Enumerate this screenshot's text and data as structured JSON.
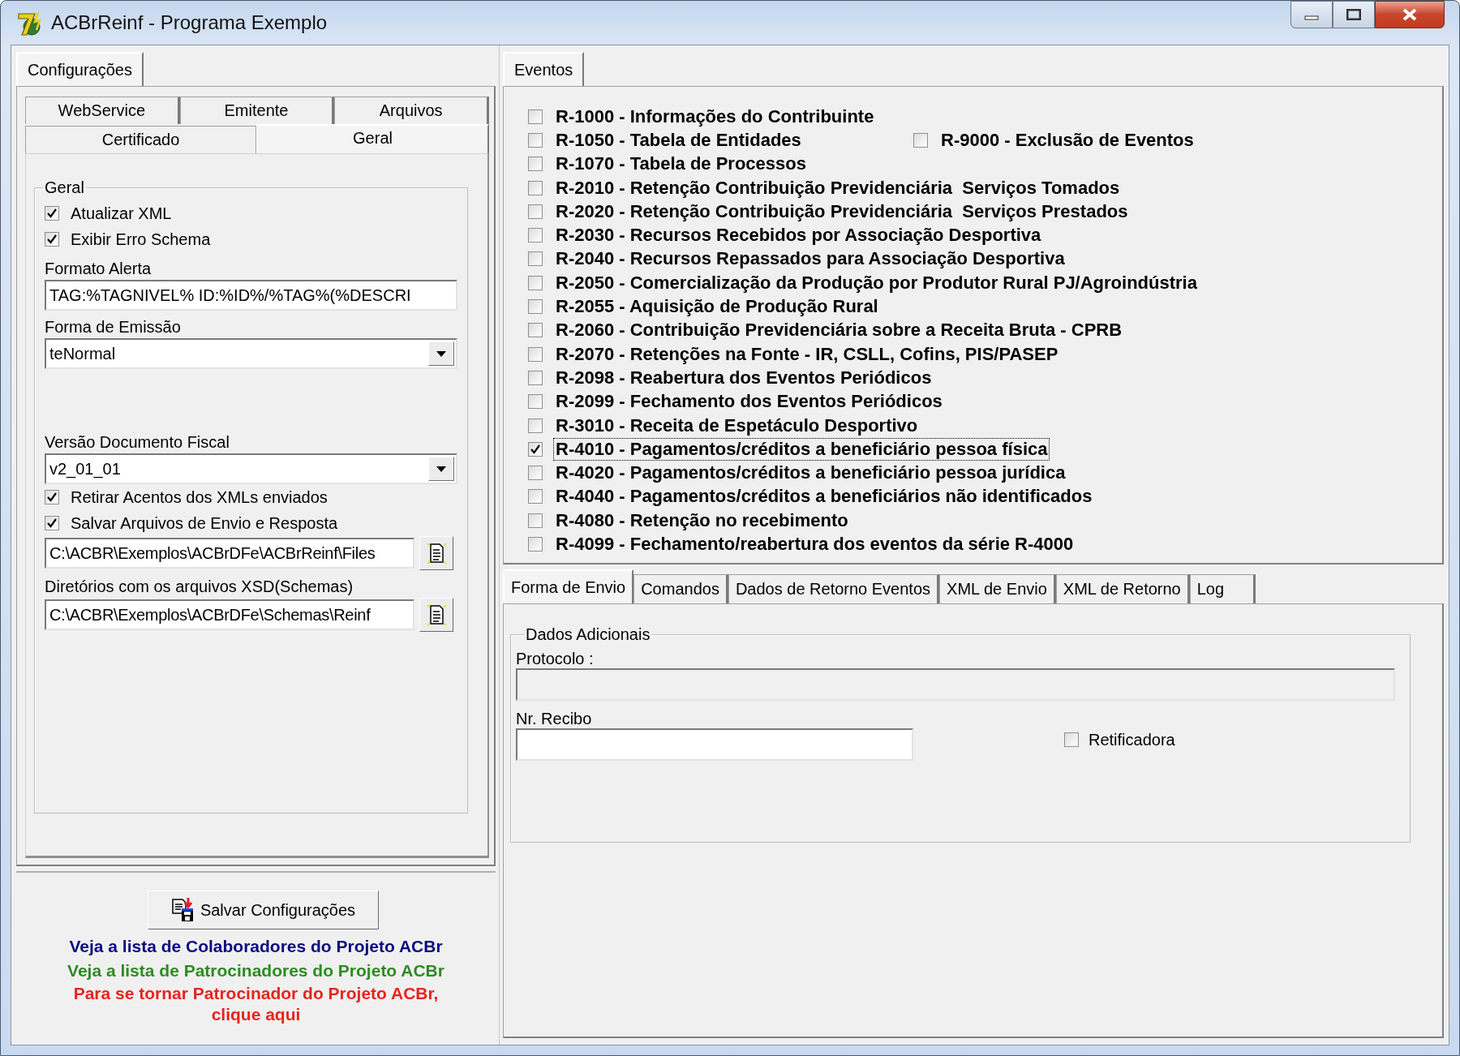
{
  "window": {
    "title": "ACBrReinf - Programa Exemplo"
  },
  "config": {
    "tab": {
      "label": "Configurações",
      "selected": true
    },
    "subtab_rows": [
      [
        {
          "label": "WebService",
          "selected": false
        },
        {
          "label": "Emitente",
          "selected": false
        },
        {
          "label": "Arquivos",
          "selected": false
        }
      ],
      [
        {
          "label": "Certificado",
          "selected": false
        },
        {
          "label": "Geral",
          "selected": true
        }
      ]
    ],
    "group_title": "Geral",
    "fields": [
      {
        "kind": "checkbox",
        "label": "Atualizar XML",
        "checked": true
      },
      {
        "kind": "checkbox",
        "label": "Exibir Erro Schema",
        "checked": true
      },
      {
        "kind": "label",
        "text": "Formato Alerta"
      },
      {
        "kind": "input",
        "value": "TAG:%TAGNIVEL% ID:%ID%/%TAG%(%DESCRI"
      },
      {
        "kind": "label",
        "text": "Forma de Emissão"
      },
      {
        "kind": "select",
        "value": "teNormal"
      },
      {
        "kind": "label",
        "text": "Versão Documento Fiscal"
      },
      {
        "kind": "select",
        "value": "v2_01_01"
      },
      {
        "kind": "checkbox",
        "label": "Retirar Acentos dos XMLs enviados",
        "checked": true
      },
      {
        "kind": "checkbox",
        "label": "Salvar Arquivos de Envio e Resposta",
        "checked": true
      },
      {
        "kind": "path",
        "value": "C:\\ACBR\\Exemplos\\ACBrDFe\\ACBrReinf\\Files"
      },
      {
        "kind": "label",
        "text": "Diretórios com os arquivos XSD(Schemas)"
      },
      {
        "kind": "path",
        "value": "C:\\ACBR\\Exemplos\\ACBrDFe\\Schemas\\Reinf"
      }
    ]
  },
  "save_button": {
    "label": "Salvar Configurações"
  },
  "links": [
    {
      "text": "Veja a lista de Colaboradores do Projeto ACBr",
      "color": "#0a0a80"
    },
    {
      "text": "Veja a lista de Patrocinadores do Projeto ACBr",
      "color": "#2e8b22"
    },
    {
      "text": "Para se tornar Patrocinador do Projeto ACBr, clique aqui",
      "color": "#e8231d"
    }
  ],
  "events_tab": {
    "label": "Eventos",
    "selected": true
  },
  "events": [
    {
      "label": "R-1000 - Informações do Contribuinte",
      "checked": false,
      "focused": false
    },
    {
      "label": "R-1050 - Tabela de Entidades",
      "checked": false,
      "focused": false,
      "beside": {
        "label": "R-9000 - Exclusão de Eventos",
        "checked": false
      }
    },
    {
      "label": "R-1070 - Tabela de Processos",
      "checked": false,
      "focused": false
    },
    {
      "label": "R-2010 - Retenção Contribuição Previdenciária  Serviços Tomados",
      "checked": false,
      "focused": false
    },
    {
      "label": "R-2020 - Retenção Contribuição Previdenciária  Serviços Prestados",
      "checked": false,
      "focused": false
    },
    {
      "label": "R-2030 - Recursos Recebidos por Associação Desportiva",
      "checked": false,
      "focused": false
    },
    {
      "label": "R-2040 - Recursos Repassados para Associação Desportiva",
      "checked": false,
      "focused": false
    },
    {
      "label": "R-2050 - Comercialização da Produção por Produtor Rural PJ/Agroindústria",
      "checked": false,
      "focused": false
    },
    {
      "label": "R-2055 - Aquisição de Produção Rural",
      "checked": false,
      "focused": false
    },
    {
      "label": "R-2060 - Contribuição Previdenciária sobre a Receita Bruta - CPRB",
      "checked": false,
      "focused": false
    },
    {
      "label": "R-2070 - Retenções na Fonte - IR, CSLL, Cofins, PIS/PASEP",
      "checked": false,
      "focused": false
    },
    {
      "label": "R-2098 - Reabertura dos Eventos Periódicos",
      "checked": false,
      "focused": false
    },
    {
      "label": "R-2099 - Fechamento dos Eventos Periódicos",
      "checked": false,
      "focused": false
    },
    {
      "label": "R-3010 - Receita de Espetáculo Desportivo",
      "checked": false,
      "focused": false
    },
    {
      "label": "R-4010 - Pagamentos/créditos a beneficiário pessoa física",
      "checked": true,
      "focused": true
    },
    {
      "label": "R-4020 - Pagamentos/créditos a beneficiário pessoa jurídica",
      "checked": false,
      "focused": false
    },
    {
      "label": "R-4040 - Pagamentos/créditos a beneficiários não identificados",
      "checked": false,
      "focused": false
    },
    {
      "label": "R-4080 - Retenção no recebimento",
      "checked": false,
      "focused": false
    },
    {
      "label": "R-4099 - Fechamento/reabertura dos eventos da série R-4000",
      "checked": false,
      "focused": false
    }
  ],
  "bottom_tabs": [
    {
      "label": "Forma de Envio",
      "selected": true
    },
    {
      "label": "Comandos",
      "selected": false
    },
    {
      "label": "Dados de Retorno Eventos",
      "selected": false
    },
    {
      "label": "XML de Envio",
      "selected": false
    },
    {
      "label": "XML de Retorno",
      "selected": false
    },
    {
      "label": "Log",
      "selected": false
    }
  ],
  "extra": {
    "group_title": "Dados Adicionais",
    "protocol_label": "Protocolo :",
    "protocol_field": {
      "disabled": true
    },
    "receipt_label": "Nr. Recibo",
    "receipt_field": {
      "disabled": false
    },
    "retificadora": {
      "label": "Retificadora",
      "checked": false
    }
  }
}
